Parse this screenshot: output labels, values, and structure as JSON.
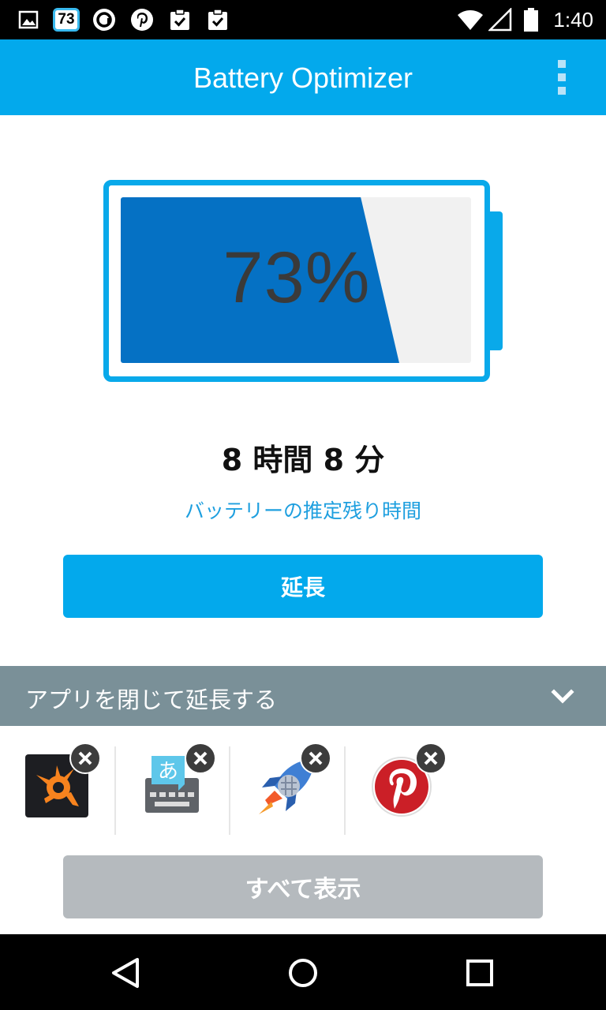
{
  "status_bar": {
    "time": "1:40",
    "badge_number": "73",
    "icons": [
      "image-icon",
      "battery-73-badge-icon",
      "avast-icon",
      "pinterest-icon",
      "clipboard-check-icon",
      "clipboard-check-icon",
      "wifi-icon",
      "signal-icon",
      "battery-icon"
    ]
  },
  "app_bar": {
    "title": "Battery Optimizer",
    "menu_icon": "more-vert-icon"
  },
  "battery": {
    "percent_text": "73%",
    "level": 0.73,
    "fill_color": "#0571c4",
    "outline_color": "#09a9ea"
  },
  "estimate": {
    "time_remaining": "8 時間 8 分",
    "label": "バッテリーの推定残り時間"
  },
  "buttons": {
    "extend_label": "延長",
    "show_all_label": "すべて表示"
  },
  "apps_section": {
    "title": "アプリを閉じて延長する",
    "apps": [
      {
        "icon": "avast-icon"
      },
      {
        "icon": "japanese-keyboard-icon"
      },
      {
        "icon": "rocket-icon"
      },
      {
        "icon": "pinterest-icon"
      }
    ]
  },
  "colors": {
    "accent": "#03a9ec",
    "section_header": "#7a9098",
    "disabled_button": "#b5babe"
  }
}
